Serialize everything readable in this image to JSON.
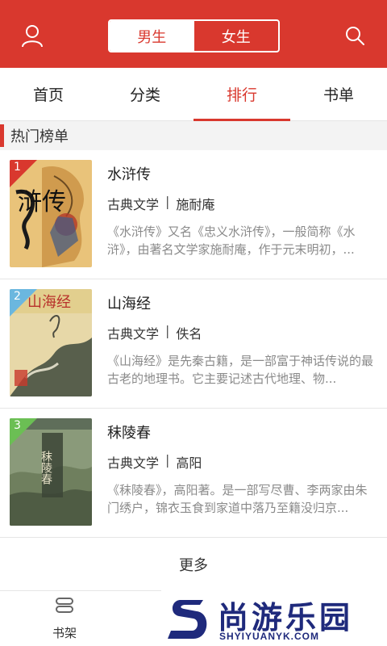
{
  "header": {
    "user_icon": "user-icon",
    "search_icon": "search-icon",
    "gender_tabs": [
      {
        "label": "男生",
        "active": true
      },
      {
        "label": "女生",
        "active": false
      }
    ],
    "accent_color": "#d9382e"
  },
  "tabs": [
    {
      "label": "首页",
      "active": false
    },
    {
      "label": "分类",
      "active": false
    },
    {
      "label": "排行",
      "active": true
    },
    {
      "label": "书单",
      "active": false
    }
  ],
  "section": {
    "title": "热门榜单"
  },
  "books": [
    {
      "rank": "1",
      "title": "水浒传",
      "category": "古典文学",
      "author": "施耐庵",
      "description": "《水浒传》又名《忠义水浒传》，一般简称《水浒》，由著名文学家施耐庵，作于元末明初，...",
      "cover_text": "浒传"
    },
    {
      "rank": "2",
      "title": "山海经",
      "category": "古典文学",
      "author": "佚名",
      "description": "《山海经》是先秦古籍，是一部富于神话传说的最古老的地理书。它主要记述古代地理、物...",
      "cover_text": "山海经"
    },
    {
      "rank": "3",
      "title": "秣陵春",
      "category": "古典文学",
      "author": "高阳",
      "description": "《秣陵春》，高阳著。是一部写尽曹、李两家由朱门绣户，锦衣玉食到家道中落乃至籍没归京...",
      "cover_text": "秣陵春"
    }
  ],
  "more_label": "更多",
  "bottom_nav": {
    "shelf_label": "书架",
    "shelf_icon": "bookshelf-icon"
  },
  "watermark": {
    "main": "尚游乐园",
    "sub": "SHYIYUANYK.COM"
  }
}
